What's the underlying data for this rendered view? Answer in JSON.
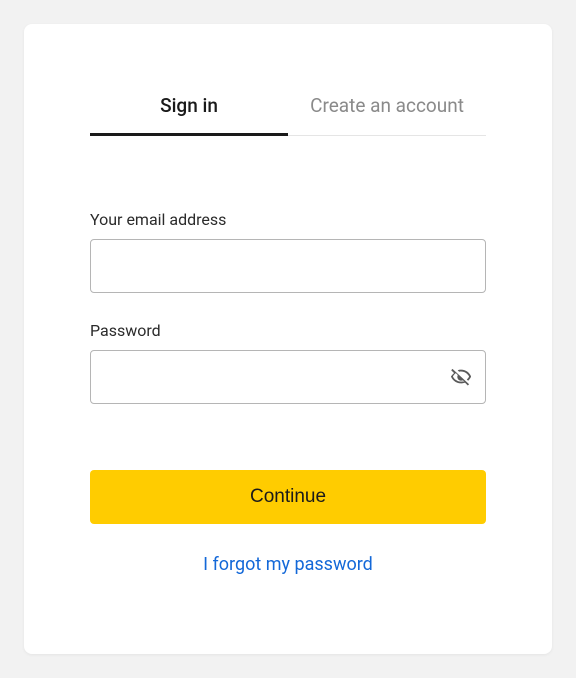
{
  "tabs": {
    "sign_in": "Sign in",
    "create_account": "Create an account"
  },
  "form": {
    "email_label": "Your email address",
    "email_value": "",
    "password_label": "Password",
    "password_value": ""
  },
  "buttons": {
    "continue": "Continue"
  },
  "links": {
    "forgot": "I forgot my password"
  }
}
